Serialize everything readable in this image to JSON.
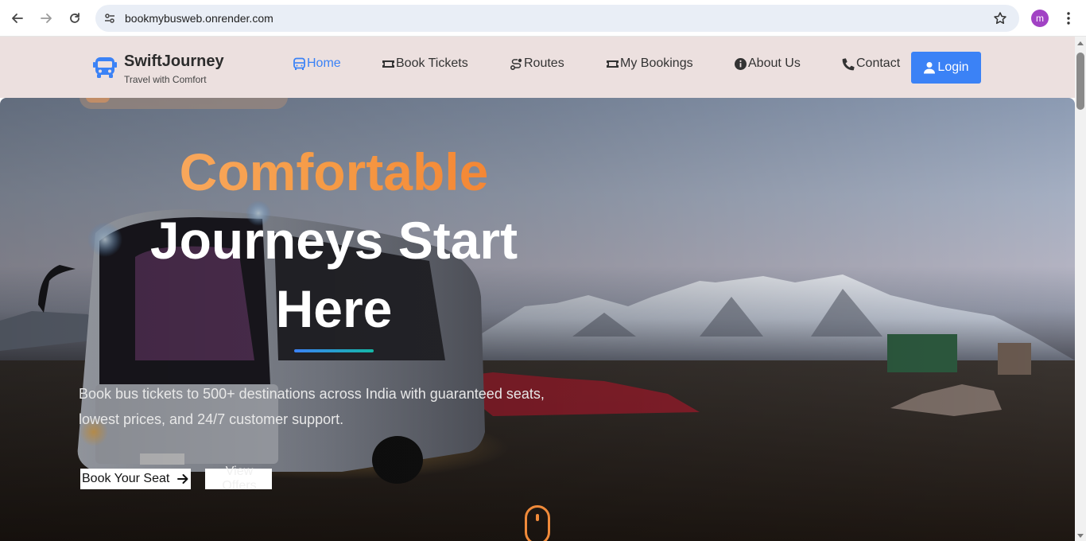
{
  "browser": {
    "url": "bookmybusweb.onrender.com",
    "profile_initial": "m"
  },
  "brand": {
    "name": "SwiftJourney",
    "tagline": "Travel with Comfort",
    "accent_color": "#3b82f6"
  },
  "nav": {
    "items": [
      {
        "label": "Home",
        "icon": "bus-icon",
        "active": true
      },
      {
        "label": "Book Tickets",
        "icon": "ticket-icon",
        "active": false
      },
      {
        "label": "Routes",
        "icon": "route-icon",
        "active": false
      },
      {
        "label": "My Bookings",
        "icon": "ticket-icon",
        "active": false
      },
      {
        "label": "About Us",
        "icon": "info-circle-icon",
        "active": false
      },
      {
        "label": "Contact",
        "icon": "phone-icon",
        "active": false
      }
    ],
    "login_label": "Login"
  },
  "hero": {
    "headline_accent": "Comfortable",
    "headline_line2": "Journeys Start",
    "headline_line3": "Here",
    "description": "Book bus tickets to 500+ destinations across India with guaranteed seats, lowest prices, and 24/7 customer support.",
    "primary_cta": "Book Your Seat",
    "secondary_cta": "View Offers",
    "accent_gradient": [
      "#3b82f6",
      "#14b8a6"
    ],
    "headline_gradient": [
      "#fbb06a",
      "#f47a2a"
    ]
  }
}
